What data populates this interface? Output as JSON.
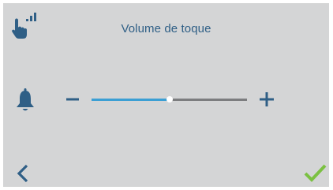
{
  "header": {
    "title": "Volume de toque"
  },
  "icons": {
    "touch": "touch-signal-icon",
    "ringtone": "bell-icon",
    "decrease": "minus-icon",
    "increase": "plus-icon",
    "back": "chevron-left-icon",
    "confirm": "checkmark-icon"
  },
  "volume": {
    "level": 0.5
  },
  "colors": {
    "background": "#d4d5d6",
    "primary": "#2f5f86",
    "slider_fill": "#3b9fd4",
    "slider_track": "#7c7d7f",
    "confirm": "#7bc142"
  }
}
